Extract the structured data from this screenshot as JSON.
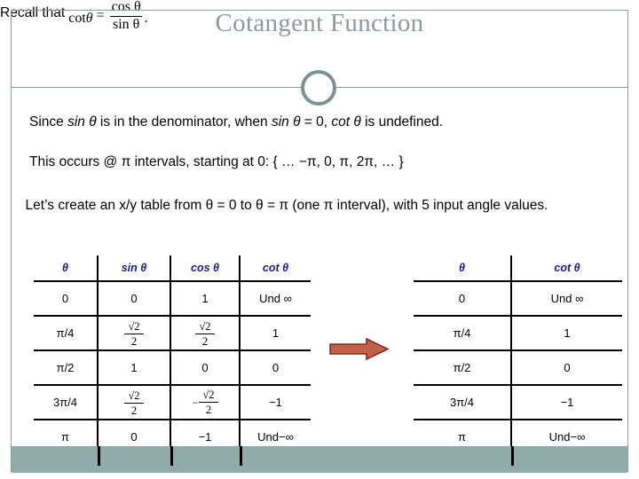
{
  "slide": {
    "title": "Cotangent Function",
    "recall_lead": "Recall that",
    "formula": {
      "cot": "cot",
      "theta": "θ",
      "equals": "=",
      "numerator": "cos θ",
      "denominator": "sin θ",
      "period": "."
    },
    "line_since": {
      "part1": "Since ",
      "em1": "sin θ",
      "part2": " is in the denominator, when ",
      "em2": "sin θ",
      "part3": " = 0, ",
      "em3": "cot θ",
      "part4": " is undefined."
    },
    "line_occurs": "This occurs @ π intervals, starting at 0:  { … −π, 0, π, 2π, … }",
    "line_lets": "Let’s create an x/y table from θ = 0 to θ = π  (one π interval), with 5 input angle values."
  },
  "table_left": {
    "headers": [
      "θ",
      "sin θ",
      "cos θ",
      "cot θ"
    ],
    "rows": [
      {
        "theta": "0",
        "sin": "0",
        "cos": "1",
        "cot": "Und ∞"
      },
      {
        "theta": "π/4",
        "sin": "sqrt2over2",
        "cos": "sqrt2over2",
        "cot": "1"
      },
      {
        "theta": "π/2",
        "sin": "1",
        "cos": "0",
        "cot": "0"
      },
      {
        "theta": "3π/4",
        "sin": "sqrt2over2",
        "cos": "neg-sqrt2over2",
        "cot": "−1"
      },
      {
        "theta": "π",
        "sin": "0",
        "cos": "−1",
        "cot": "Und−∞"
      }
    ]
  },
  "table_right": {
    "headers": [
      "θ",
      "cot θ"
    ],
    "rows": [
      {
        "theta": "0",
        "cot": "Und ∞"
      },
      {
        "theta": "π/4",
        "cot": "1"
      },
      {
        "theta": "π/2",
        "cot": "0"
      },
      {
        "theta": "3π/4",
        "cot": "−1"
      },
      {
        "theta": "π",
        "cot": "Und−∞"
      }
    ]
  },
  "fraction_glyphs": {
    "sqrt2": "√2",
    "two": "2",
    "minus": "−"
  },
  "colors": {
    "title": "#8a9b9d",
    "rule": "#8c9a9c",
    "ring": "#7d9193",
    "header_text": "#1a1a8c",
    "arrow_fill": "#c2604a",
    "arrow_stroke": "#7a3121",
    "bottom_bar": "#8fabaa",
    "body_text": "#000000"
  },
  "decorations": {
    "ring_icon": "circle-ring",
    "arrow_icon": "right-arrow"
  }
}
